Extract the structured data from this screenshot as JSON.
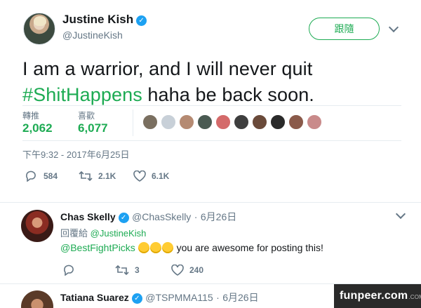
{
  "author": {
    "name": "Justine Kish",
    "handle": "@JustineKish",
    "follow_label": "跟隨"
  },
  "tweet": {
    "text_line1": "I am a warrior, and I will never quit",
    "hashtag": "#ShitHappens",
    "text_line2_rest": " haha be back soon.",
    "timestamp": "下午9:32 - 2017年6月25日"
  },
  "stats": {
    "retweets_label": "轉推",
    "retweets_value": "2,062",
    "likes_label": "喜歡",
    "likes_value": "6,077",
    "liker_colors": [
      "#7a6f60",
      "#c8d0d8",
      "#b58a72",
      "#4a5a52",
      "#d46a6a",
      "#3e3e3e",
      "#6a4a3a",
      "#2a2a2a",
      "#8a5a4a",
      "#c98a8a"
    ]
  },
  "actions": {
    "replies": "584",
    "retweets": "2.1K",
    "likes": "6.1K"
  },
  "replies": [
    {
      "name": "Chas Skelly",
      "handle": "@ChasSkelly",
      "date": "6月26日",
      "reply_to_label": "回覆給",
      "reply_to": "@JustineKish",
      "mention": "@BestFightPicks",
      "body": " you are awesome for posting this!",
      "reply_count": "",
      "retweet_count": "3",
      "like_count": "240"
    },
    {
      "name": "Tatiana Suarez",
      "handle": "@TSPMMA115",
      "date": "6月26日"
    }
  ],
  "watermark": {
    "text": "funpeer.com",
    "suffix": ".COM"
  },
  "colors": {
    "accent_green": "#1dab53",
    "verified_blue": "#1da1f2",
    "muted": "#657786"
  }
}
